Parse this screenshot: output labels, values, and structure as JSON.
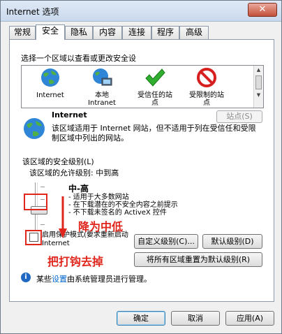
{
  "window": {
    "title": "Internet 选项",
    "close_glyph": "✕"
  },
  "tabs": [
    "常规",
    "安全",
    "隐私",
    "内容",
    "连接",
    "程序",
    "高级"
  ],
  "zones": {
    "caption": "选择一个区域以查看或更改安全设",
    "items": [
      {
        "label": "Internet",
        "icon": "globe-icon"
      },
      {
        "label": "本地\nIntranet",
        "icon": "intranet-icon"
      },
      {
        "label": "受信任的站\n点",
        "icon": "trusted-check-icon"
      },
      {
        "label": "受限制的站\n点",
        "icon": "restricted-icon"
      }
    ],
    "scroll_up": "▲",
    "scroll_down": "▼"
  },
  "selected_zone": {
    "title": "Internet",
    "sites_button": "站点(S)",
    "description": "该区域适用于 Internet 网站，但不适用于列在受信任和受限制区域中列出的网站。"
  },
  "security_level": {
    "group_title": "该区域的安全级别(L)",
    "allowed": "该区域的允许级别: 中到高",
    "level_name": "中-高",
    "bullets": [
      "- 适用于大多数网站",
      "- 在下载潜在的不安全内容之前提示",
      "- 不下载未签名的 ActiveX 控件"
    ],
    "slider_level": "中-高"
  },
  "protected_mode": {
    "label": "启用保护模式(要求重新启动 Internet",
    "checked": false
  },
  "buttons": {
    "custom_level": "自定义级别(C)...",
    "default_level": "默认级别(D)",
    "reset_all": "将所有区域重置为默认级别(R)",
    "ok": "确定",
    "cancel": "取消",
    "apply": "应用(A)"
  },
  "info": {
    "prefix": "某些",
    "link": "设置",
    "suffix": "由系统管理员进行管理。"
  },
  "annotations": {
    "lower": "降为中低",
    "uncheck": "把打钩去掉"
  },
  "colors": {
    "annotation_red": "#e0261c",
    "accent_blue": "#1f69c4"
  }
}
